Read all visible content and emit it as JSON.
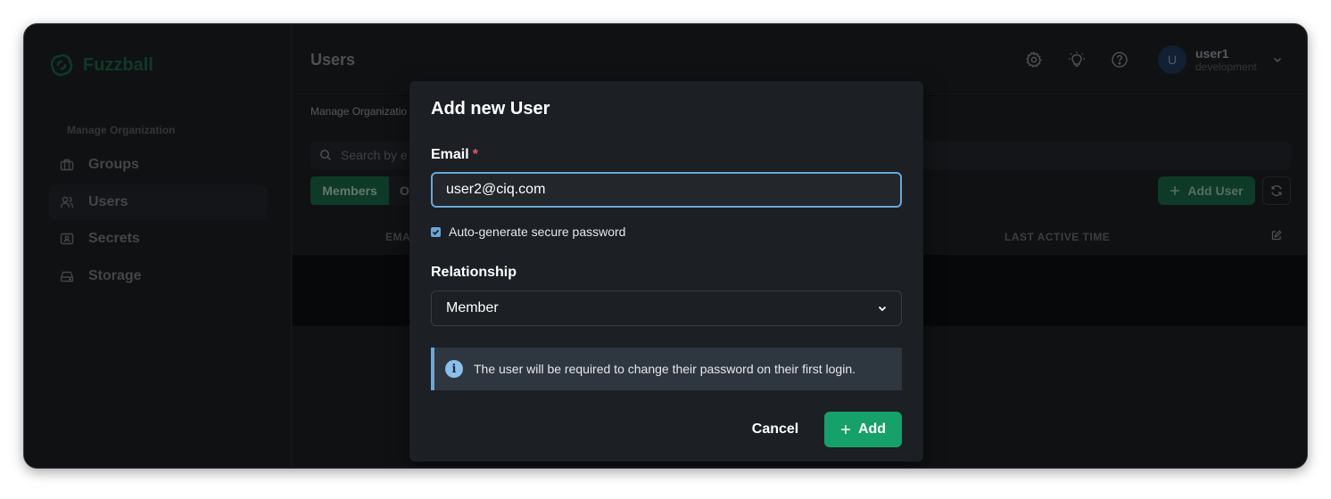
{
  "app": {
    "name": "Fuzzball"
  },
  "sidebar": {
    "section_title": "Manage Organization",
    "items": [
      {
        "label": "Groups",
        "icon": "briefcase-icon"
      },
      {
        "label": "Users",
        "icon": "users-icon",
        "active": true
      },
      {
        "label": "Secrets",
        "icon": "id-card-icon"
      },
      {
        "label": "Storage",
        "icon": "hard-drive-icon"
      }
    ]
  },
  "header": {
    "title": "Users",
    "icons": [
      "gear-icon",
      "lightbulb-icon",
      "help-icon"
    ],
    "user": {
      "avatar_initial": "U",
      "name": "user1",
      "environment": "development"
    }
  },
  "content": {
    "breadcrumb": "Manage Organizatio",
    "search_placeholder": "Search by e",
    "tabs": {
      "members": "Members",
      "other": "O"
    },
    "add_user_label": "Add User",
    "columns": {
      "email": "EMA",
      "last_active": "LAST ACTIVE TIME"
    }
  },
  "modal": {
    "title": "Add new User",
    "email_label": "Email",
    "required_mark": "*",
    "email_value": "user2@ciq.com",
    "auto_password_label": "Auto-generate secure password",
    "auto_password_checked": true,
    "relationship_label": "Relationship",
    "relationship_value": "Member",
    "info_text": "The user will be required to change their password on their first login.",
    "cancel_label": "Cancel",
    "add_label": "Add"
  },
  "colors": {
    "brand": "#1a6b49",
    "primary_button": "#16a06a",
    "focus_blue": "#6aa7d6",
    "required": "#e05b6a"
  }
}
